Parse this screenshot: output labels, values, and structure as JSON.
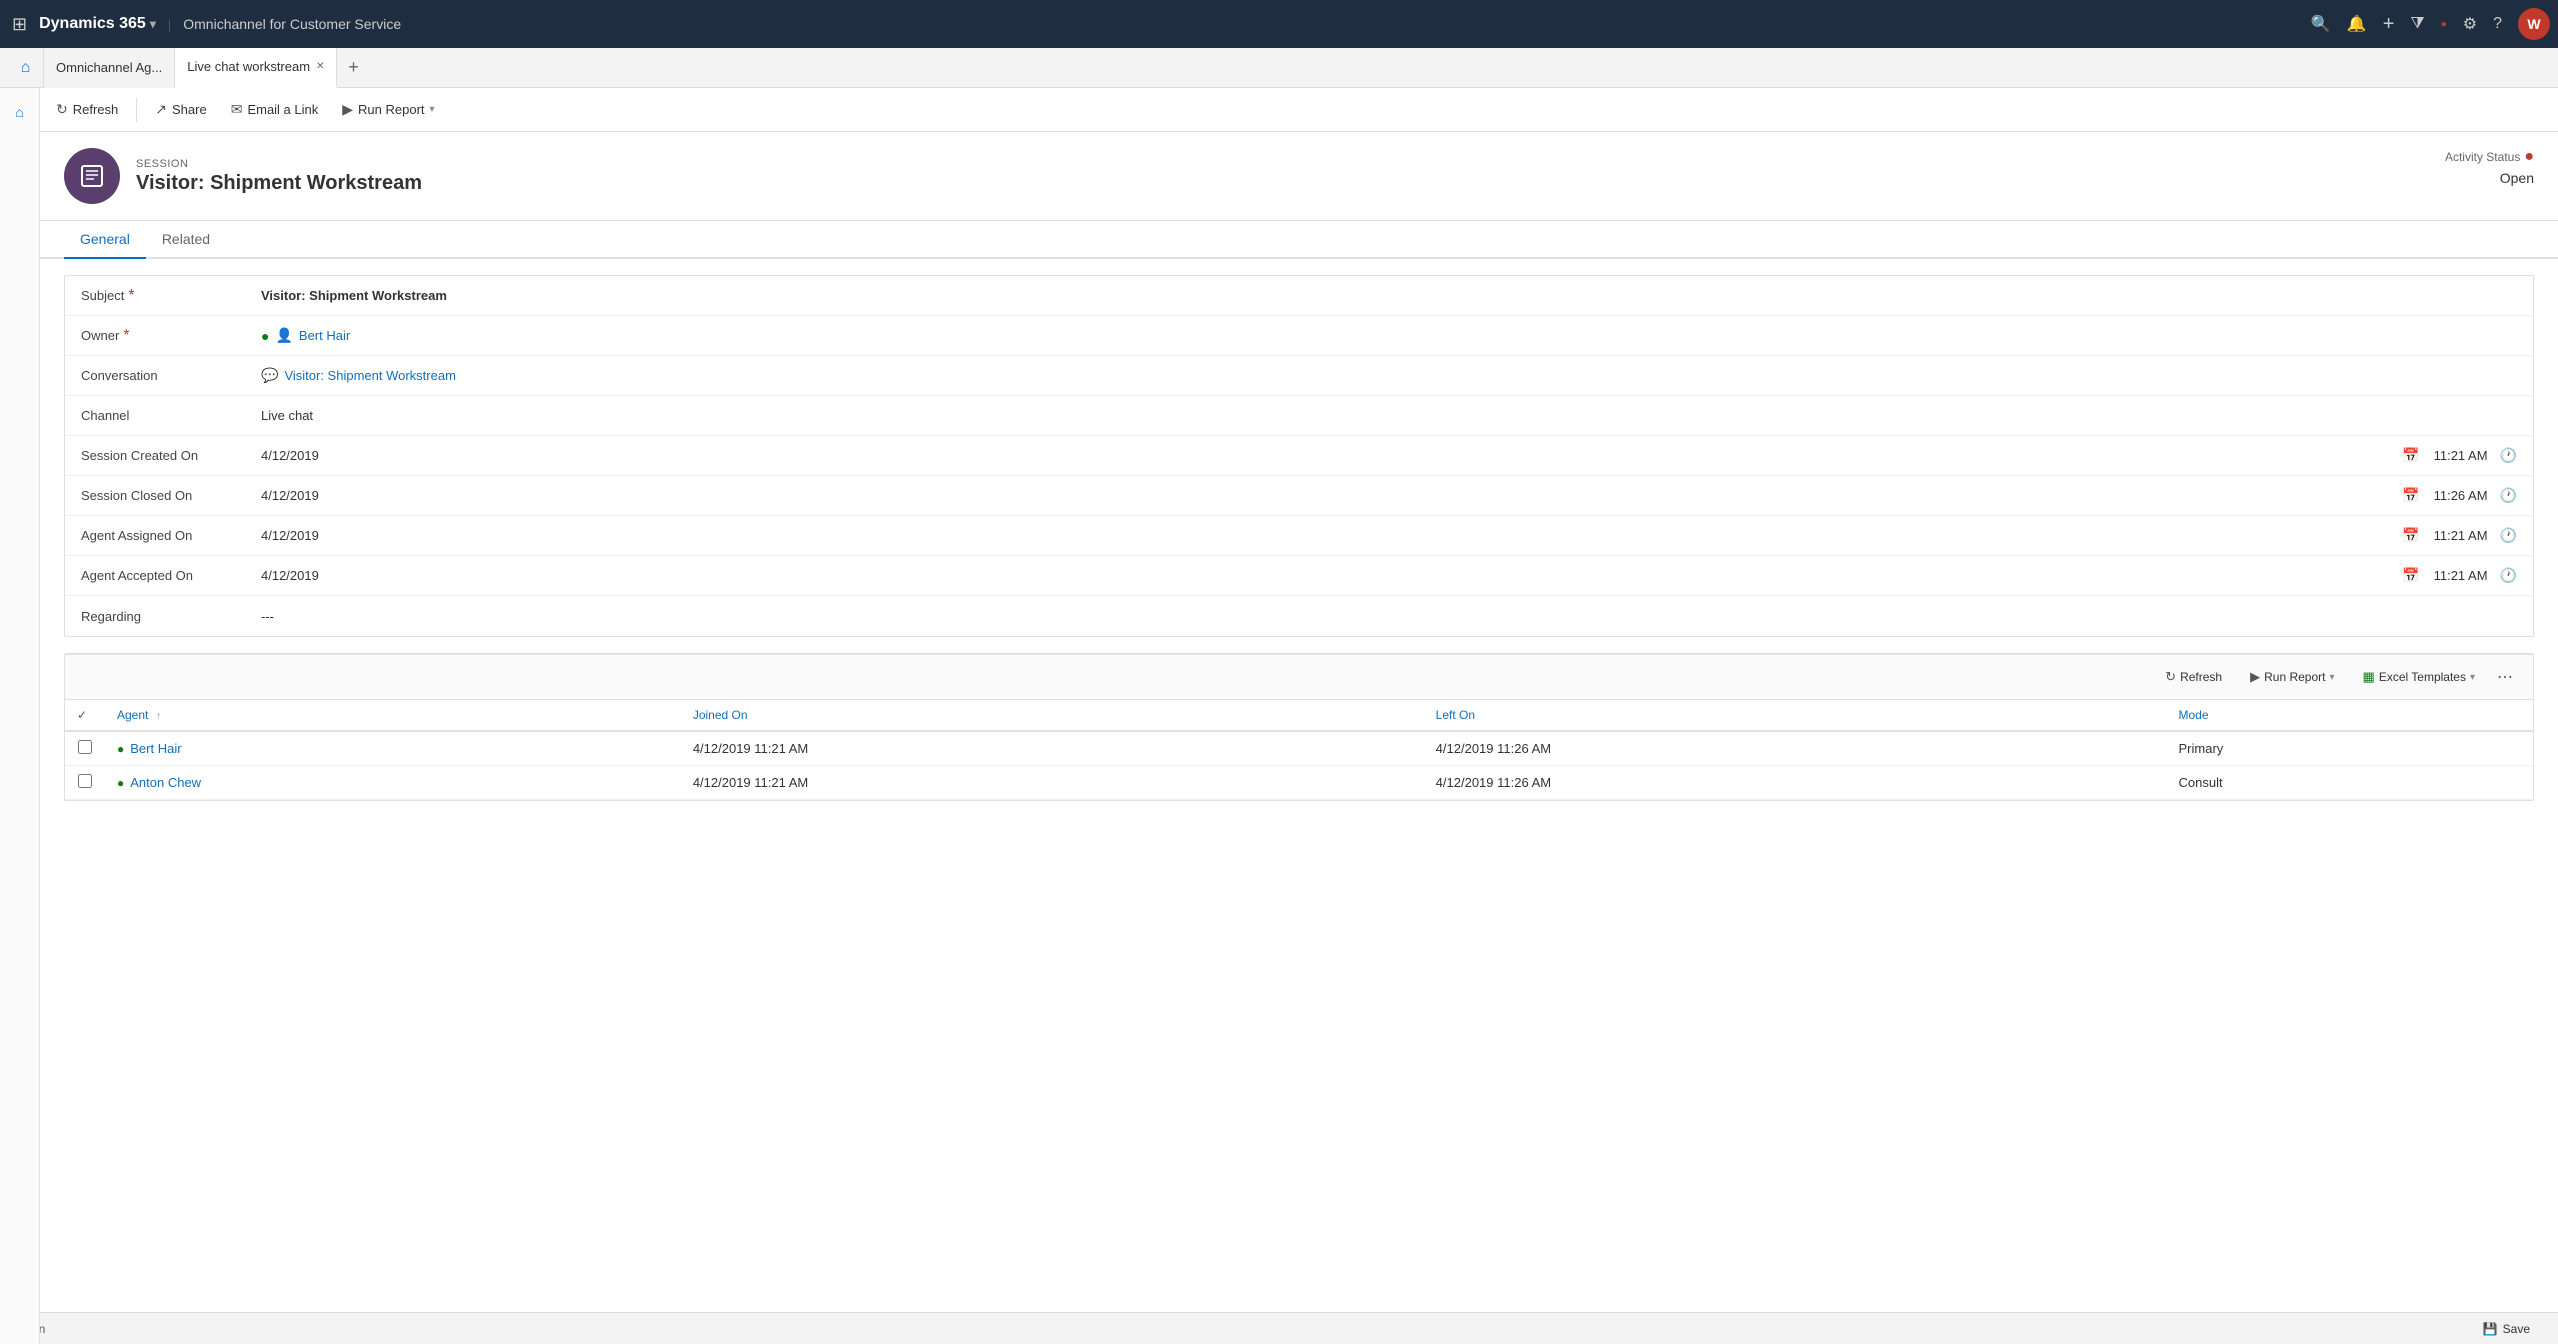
{
  "app": {
    "title": "Dynamics 365",
    "module": "Omnichannel for Customer Service"
  },
  "tabs": [
    {
      "id": "omni",
      "label": "Omnichannel Ag...",
      "active": false,
      "closeable": false
    },
    {
      "id": "livechat",
      "label": "Live chat workstream",
      "active": true,
      "closeable": true
    }
  ],
  "toolbar": {
    "back_label": "",
    "refresh_label": "Refresh",
    "share_label": "Share",
    "email_label": "Email a Link",
    "run_report_label": "Run Report"
  },
  "record": {
    "type": "SESSION",
    "title": "Visitor: Shipment Workstream",
    "icon": "session-icon",
    "status_label": "Activity Status",
    "status_value": "Open"
  },
  "tabs_content": [
    {
      "id": "general",
      "label": "General",
      "active": true
    },
    {
      "id": "related",
      "label": "Related",
      "active": false
    }
  ],
  "form": {
    "fields": [
      {
        "label": "Subject",
        "required": true,
        "value": "Visitor: Shipment Workstream",
        "type": "text-bold"
      },
      {
        "label": "Owner",
        "required": true,
        "value": "Bert Hair",
        "type": "user-link"
      },
      {
        "label": "Conversation",
        "required": false,
        "value": "Visitor: Shipment Workstream",
        "type": "entity-link"
      },
      {
        "label": "Channel",
        "required": false,
        "value": "Live chat",
        "type": "text"
      },
      {
        "label": "Session Created On",
        "required": false,
        "date": "4/12/2019",
        "time": "11:21 AM",
        "type": "datetime"
      },
      {
        "label": "Session Closed On",
        "required": false,
        "date": "4/12/2019",
        "time": "11:26 AM",
        "type": "datetime"
      },
      {
        "label": "Agent Assigned On",
        "required": false,
        "date": "4/12/2019",
        "time": "11:21 AM",
        "type": "datetime"
      },
      {
        "label": "Agent Accepted On",
        "required": false,
        "date": "4/12/2019",
        "time": "11:21 AM",
        "type": "datetime"
      },
      {
        "label": "Regarding",
        "required": false,
        "value": "---",
        "type": "text"
      }
    ]
  },
  "subgrid": {
    "refresh_label": "Refresh",
    "run_report_label": "Run Report",
    "excel_templates_label": "Excel Templates",
    "columns": [
      {
        "id": "agent",
        "label": "Agent",
        "sortable": true
      },
      {
        "id": "joined_on",
        "label": "Joined On",
        "sortable": false
      },
      {
        "id": "left_on",
        "label": "Left On",
        "sortable": false
      },
      {
        "id": "mode",
        "label": "Mode",
        "sortable": false
      }
    ],
    "rows": [
      {
        "agent": "Bert Hair",
        "joined_on": "4/12/2019 11:21 AM",
        "left_on": "4/12/2019 11:26 AM",
        "mode": "Primary"
      },
      {
        "agent": "Anton Chew",
        "joined_on": "4/12/2019 11:21 AM",
        "left_on": "4/12/2019 11:26 AM",
        "mode": "Consult"
      }
    ]
  },
  "bottom": {
    "status": "Open",
    "save_label": "Save"
  },
  "icons": {
    "grid": "⊞",
    "chevron_down": "▾",
    "home": "⌂",
    "back": "←",
    "refresh": "↻",
    "share": "↗",
    "email": "✉",
    "report": "▶",
    "search": "🔍",
    "bell": "🔔",
    "plus": "+",
    "filter": "⧩",
    "record_dot": "●",
    "settings": "⚙",
    "help": "?",
    "user": "👤",
    "calendar": "📅",
    "clock": "🕐",
    "entity": "💬",
    "check": "✓",
    "sort_up": "↑",
    "more": "⋯"
  }
}
